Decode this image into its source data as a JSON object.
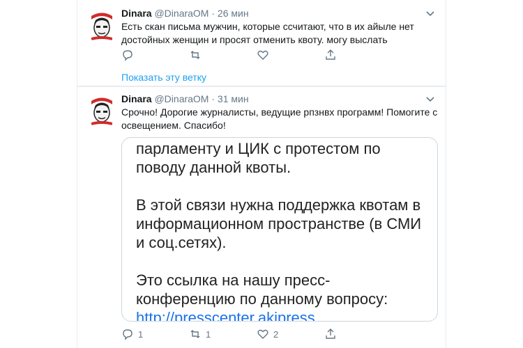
{
  "tweets": [
    {
      "name": "Dinara",
      "handle": "@DinaraOM",
      "time": "· 26 мин",
      "text": "Есть скан письма мужчин, которые ссчитают, что в их айыле нет достойных женщин и просят отменить квоту. могу выслать",
      "reply_count": "",
      "retweet_count": "",
      "like_count": "",
      "avatar_label": "corruption watchers"
    },
    {
      "name": "Dinara",
      "handle": "@DinaraOM",
      "time": "· 31 мин",
      "text": "Срочно! Дорогие журналисты, ведущие рпзнвх программ! Помогите с освещением. Спасибо!",
      "reply_count": "1",
      "retweet_count": "1",
      "like_count": "2",
      "avatar_label": "corruption watchers"
    }
  ],
  "thread_link": "Показать эту ветку",
  "media": {
    "line1": "парламенту и ЦИК с протестом по поводу данной квоты.",
    "line2": "В этой связи нужна поддержка квотам в информационном пространстве (в СМИ и соц.сетях).",
    "line3": "Это ссылка на нашу пресс-конференцию по данному вопросу:",
    "link": "http://presscenter.akipress"
  },
  "colors": {
    "accent": "#1da1f2",
    "muted": "#657786",
    "divider": "#e6ecf0"
  }
}
